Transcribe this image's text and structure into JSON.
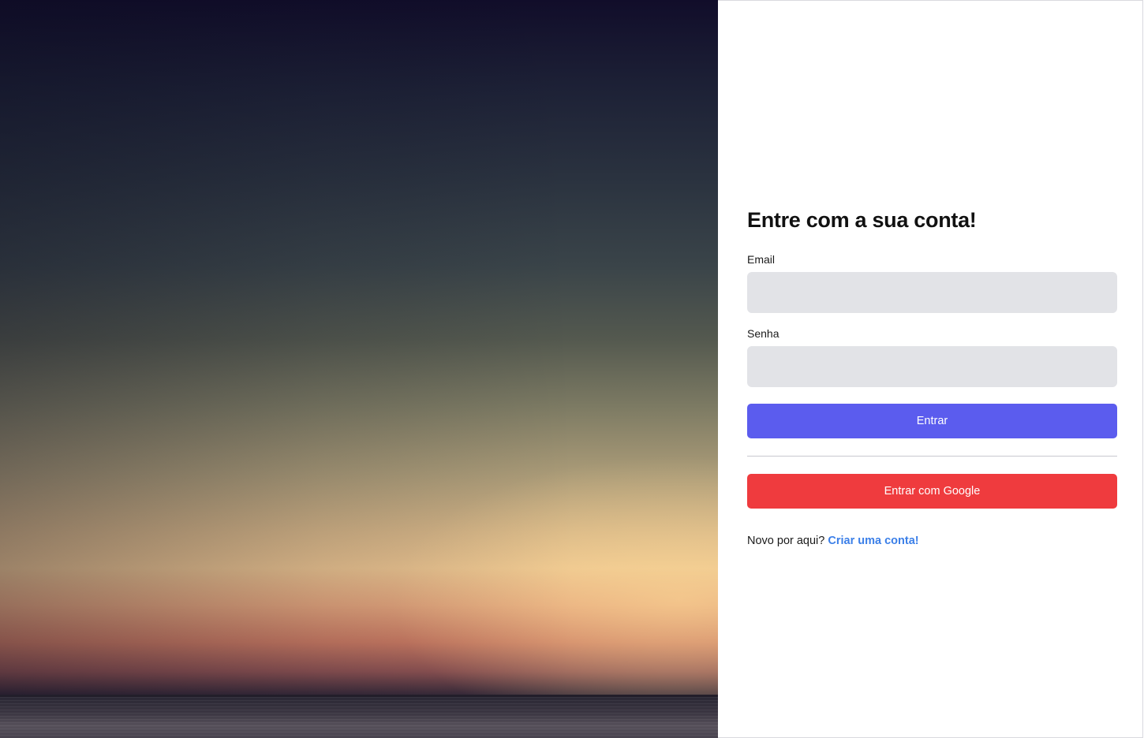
{
  "login": {
    "title": "Entre com a sua conta!",
    "email_label": "Email",
    "email_value": "",
    "password_label": "Senha",
    "password_value": "",
    "submit_label": "Entrar",
    "google_label": "Entrar com Google",
    "signup_prompt": "Novo por aqui?",
    "signup_link": "Criar uma conta!"
  },
  "colors": {
    "primary_button": "#5b5cee",
    "google_button": "#ef3b3e",
    "link": "#3b7fe8",
    "input_background": "#e2e3e7"
  }
}
